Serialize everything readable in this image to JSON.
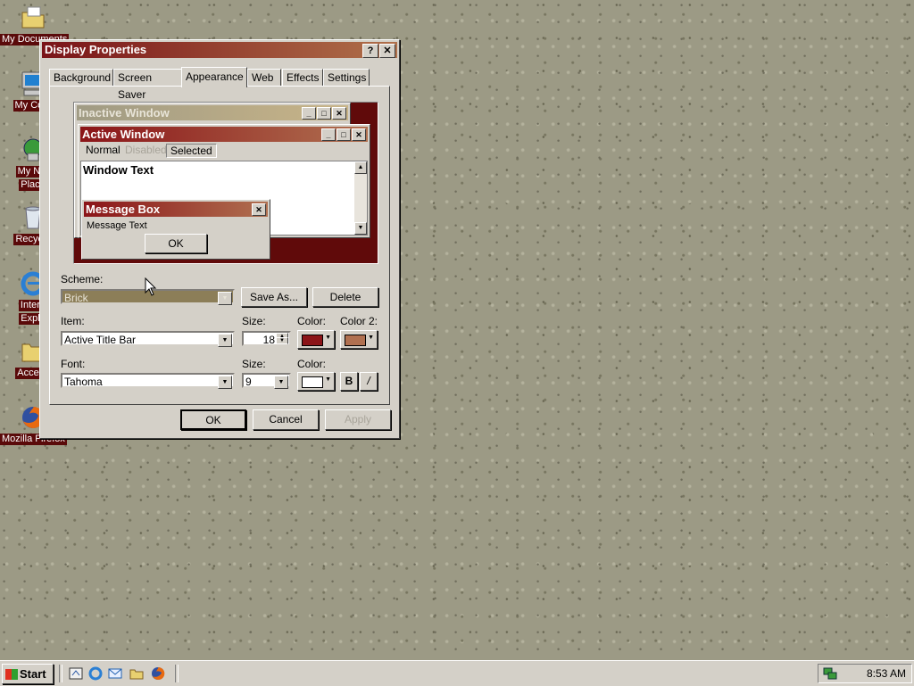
{
  "desktop": {
    "icons": [
      {
        "label": "My Documents",
        "icon": "folder-documents-icon"
      },
      {
        "label": "My Computer",
        "icon": "computer-icon"
      },
      {
        "label": "My Network Places",
        "line1": "My Net",
        "line2": "Place",
        "icon": "network-icon"
      },
      {
        "label": "Recycle Bin",
        "icon": "recycle-bin-icon"
      },
      {
        "label": "Internet Explorer",
        "line1": "Intern",
        "line2": "Explo",
        "icon": "ie-icon"
      },
      {
        "label": "Accessories",
        "icon": "folder-icon"
      },
      {
        "label": "Mozilla Firefox",
        "icon": "firefox-icon"
      }
    ]
  },
  "dialog": {
    "title": "Display Properties",
    "help": "?",
    "close": "✕",
    "tabs": [
      "Background",
      "Screen Saver",
      "Appearance",
      "Web",
      "Effects",
      "Settings"
    ],
    "active_tab": "Appearance",
    "preview": {
      "inactive_title": "Inactive Window",
      "active_title": "Active Window",
      "menu": [
        "Normal",
        "Disabled",
        "Selected"
      ],
      "window_text": "Window Text",
      "msg_title": "Message Box",
      "msg_text": "Message Text",
      "msg_ok": "OK"
    },
    "scheme_label": "Scheme:",
    "scheme_value": "Brick",
    "save_as": "Save As...",
    "delete": "Delete",
    "item_label": "Item:",
    "item_value": "Active Title Bar",
    "size_label": "Size:",
    "item_size": "18",
    "color_label": "Color:",
    "color2_label": "Color 2:",
    "color1_hex": "#8b1418",
    "color2_hex": "#b07050",
    "font_label": "Font:",
    "font_value": "Tahoma",
    "font_size_label": "Size:",
    "font_size": "9",
    "font_color_label": "Color:",
    "font_color_hex": "#ffffff",
    "bold": "B",
    "italic": "/",
    "ok": "OK",
    "cancel": "Cancel",
    "apply": "Apply"
  },
  "taskbar": {
    "start": "Start",
    "clock": "8:53 AM"
  },
  "colors": {
    "title_left": "#7a1418",
    "title_right": "#b0704a",
    "preview_bg": "#600a0a"
  }
}
